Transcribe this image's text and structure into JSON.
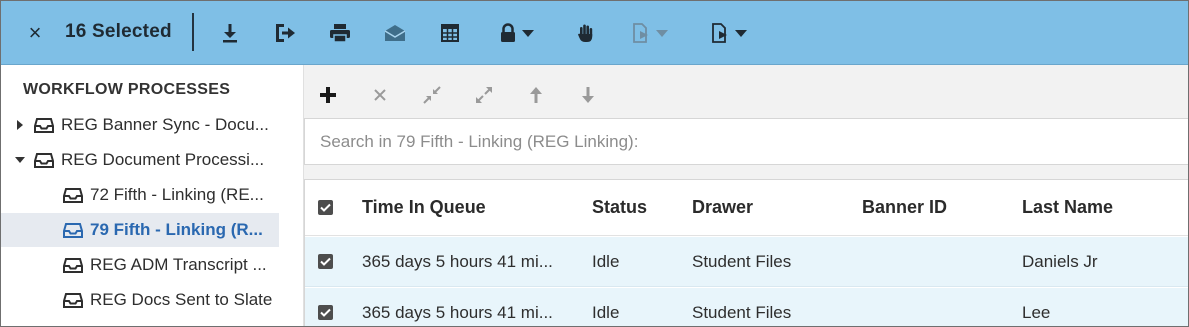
{
  "toolbar": {
    "close_label": "×",
    "selected_label": "16 Selected",
    "buttons": [
      {
        "name": "download-icon"
      },
      {
        "name": "route-icon"
      },
      {
        "name": "print-icon"
      },
      {
        "name": "email-icon"
      },
      {
        "name": "table-icon"
      },
      {
        "name": "lock-icon"
      },
      {
        "name": "hand-icon"
      },
      {
        "name": "document-move-icon"
      },
      {
        "name": "document-export-icon"
      }
    ]
  },
  "sidebar": {
    "title": "WORKFLOW PROCESSES",
    "items": [
      {
        "label": "REG Banner Sync - Docu...",
        "level": 0,
        "expand": "collapsed",
        "active": false
      },
      {
        "label": "REG Document Processi...",
        "level": 0,
        "expand": "expanded",
        "active": false
      },
      {
        "label": "72 Fifth - Linking (RE...",
        "level": 1,
        "active": false
      },
      {
        "label": "79 Fifth - Linking (R...",
        "level": 1,
        "active": true
      },
      {
        "label": "REG ADM Transcript ...",
        "level": 1,
        "active": false
      },
      {
        "label": "REG Docs Sent to Slate",
        "level": 1,
        "active": false
      }
    ]
  },
  "main": {
    "actions": [
      {
        "name": "add-icon",
        "symbol": "+"
      },
      {
        "name": "remove-icon",
        "symbol": "×"
      },
      {
        "name": "collapse-icon"
      },
      {
        "name": "expand-icon"
      },
      {
        "name": "move-up-icon"
      },
      {
        "name": "move-down-icon"
      }
    ],
    "search_placeholder": "Search in 79 Fifth - Linking (REG Linking):"
  },
  "table": {
    "columns": [
      "Time In Queue",
      "Status",
      "Drawer",
      "Banner ID",
      "Last Name"
    ],
    "rows": [
      {
        "time_in_queue": "365 days 5 hours 41 mi...",
        "status": "Idle",
        "drawer": "Student Files",
        "banner_id": "",
        "last_name": "Daniels Jr",
        "checked": true
      },
      {
        "time_in_queue": "365 days 5 hours 41 mi...",
        "status": "Idle",
        "drawer": "Student Files",
        "banner_id": "",
        "last_name": "Lee",
        "checked": true
      }
    ]
  },
  "colors": {
    "toolbar_bg": "#7fbfe6",
    "active_item_text": "#2a68b0",
    "active_item_bg": "#e6eaf0",
    "selected_row_bg": "#e8f5fb"
  }
}
